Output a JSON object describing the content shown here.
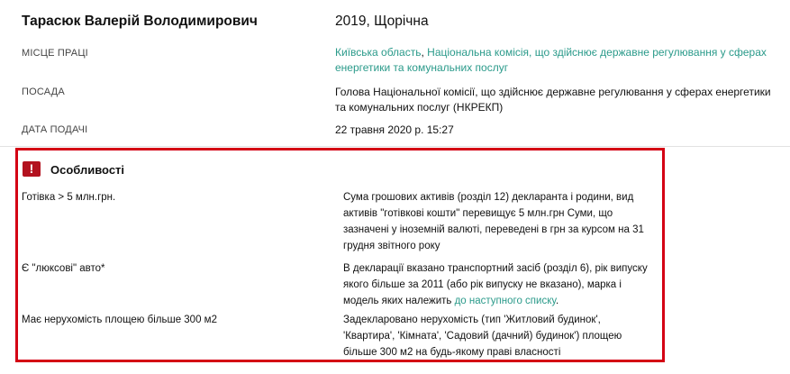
{
  "header": {
    "person_name": "Тарасюк Валерій Володимирович",
    "declaration": "2019, Щорічна"
  },
  "info": {
    "workplace_label": "МІСЦЕ ПРАЦІ",
    "workplace_region": "Київська область",
    "workplace_sep": ", ",
    "workplace_org": "Національна комісія, що здійснює державне регулювання у сферах енергетики та комунальних послуг",
    "position_label": "ПОСАДА",
    "position_value": "Голова Національної комісії, що здійснює державне регулювання у сферах енергетики та комунальних послуг (НКРЕКП)",
    "date_label": "ДАТА ПОДАЧІ",
    "date_value": "22 травня 2020 р. 15:27"
  },
  "features": {
    "icon": "warning-icon",
    "icon_glyph": "!",
    "title": "Особливості",
    "accent_color": "#d40014",
    "items": [
      {
        "rule": "Готівка > 5 млн.грн.",
        "desc": "Сума грошових активів (розділ 12) декларанта і родини, вид активів \"готівкові кошти\" перевищує 5 млн.грн Суми, що зазначені у іноземній валюті, переведені в грн за курсом на 31 грудня звітного року"
      },
      {
        "rule": "Є \"люксові\" авто*",
        "desc": "В декларації вказано транспортний засіб (розділ 6), рік випуску якого більше за 2011 (або рік випуску не вказано), марка і модель яких належить ",
        "link": "до наступного списку",
        "desc_end": "."
      },
      {
        "rule": "Має нерухомість площею більше 300 м2",
        "desc": "Задекларовано нерухомість (тип 'Житловий будинок', 'Квартира', 'Кімната', 'Садовий (дачний) будинок') площею більше 300 м2 на будь-якому праві власності"
      }
    ]
  }
}
